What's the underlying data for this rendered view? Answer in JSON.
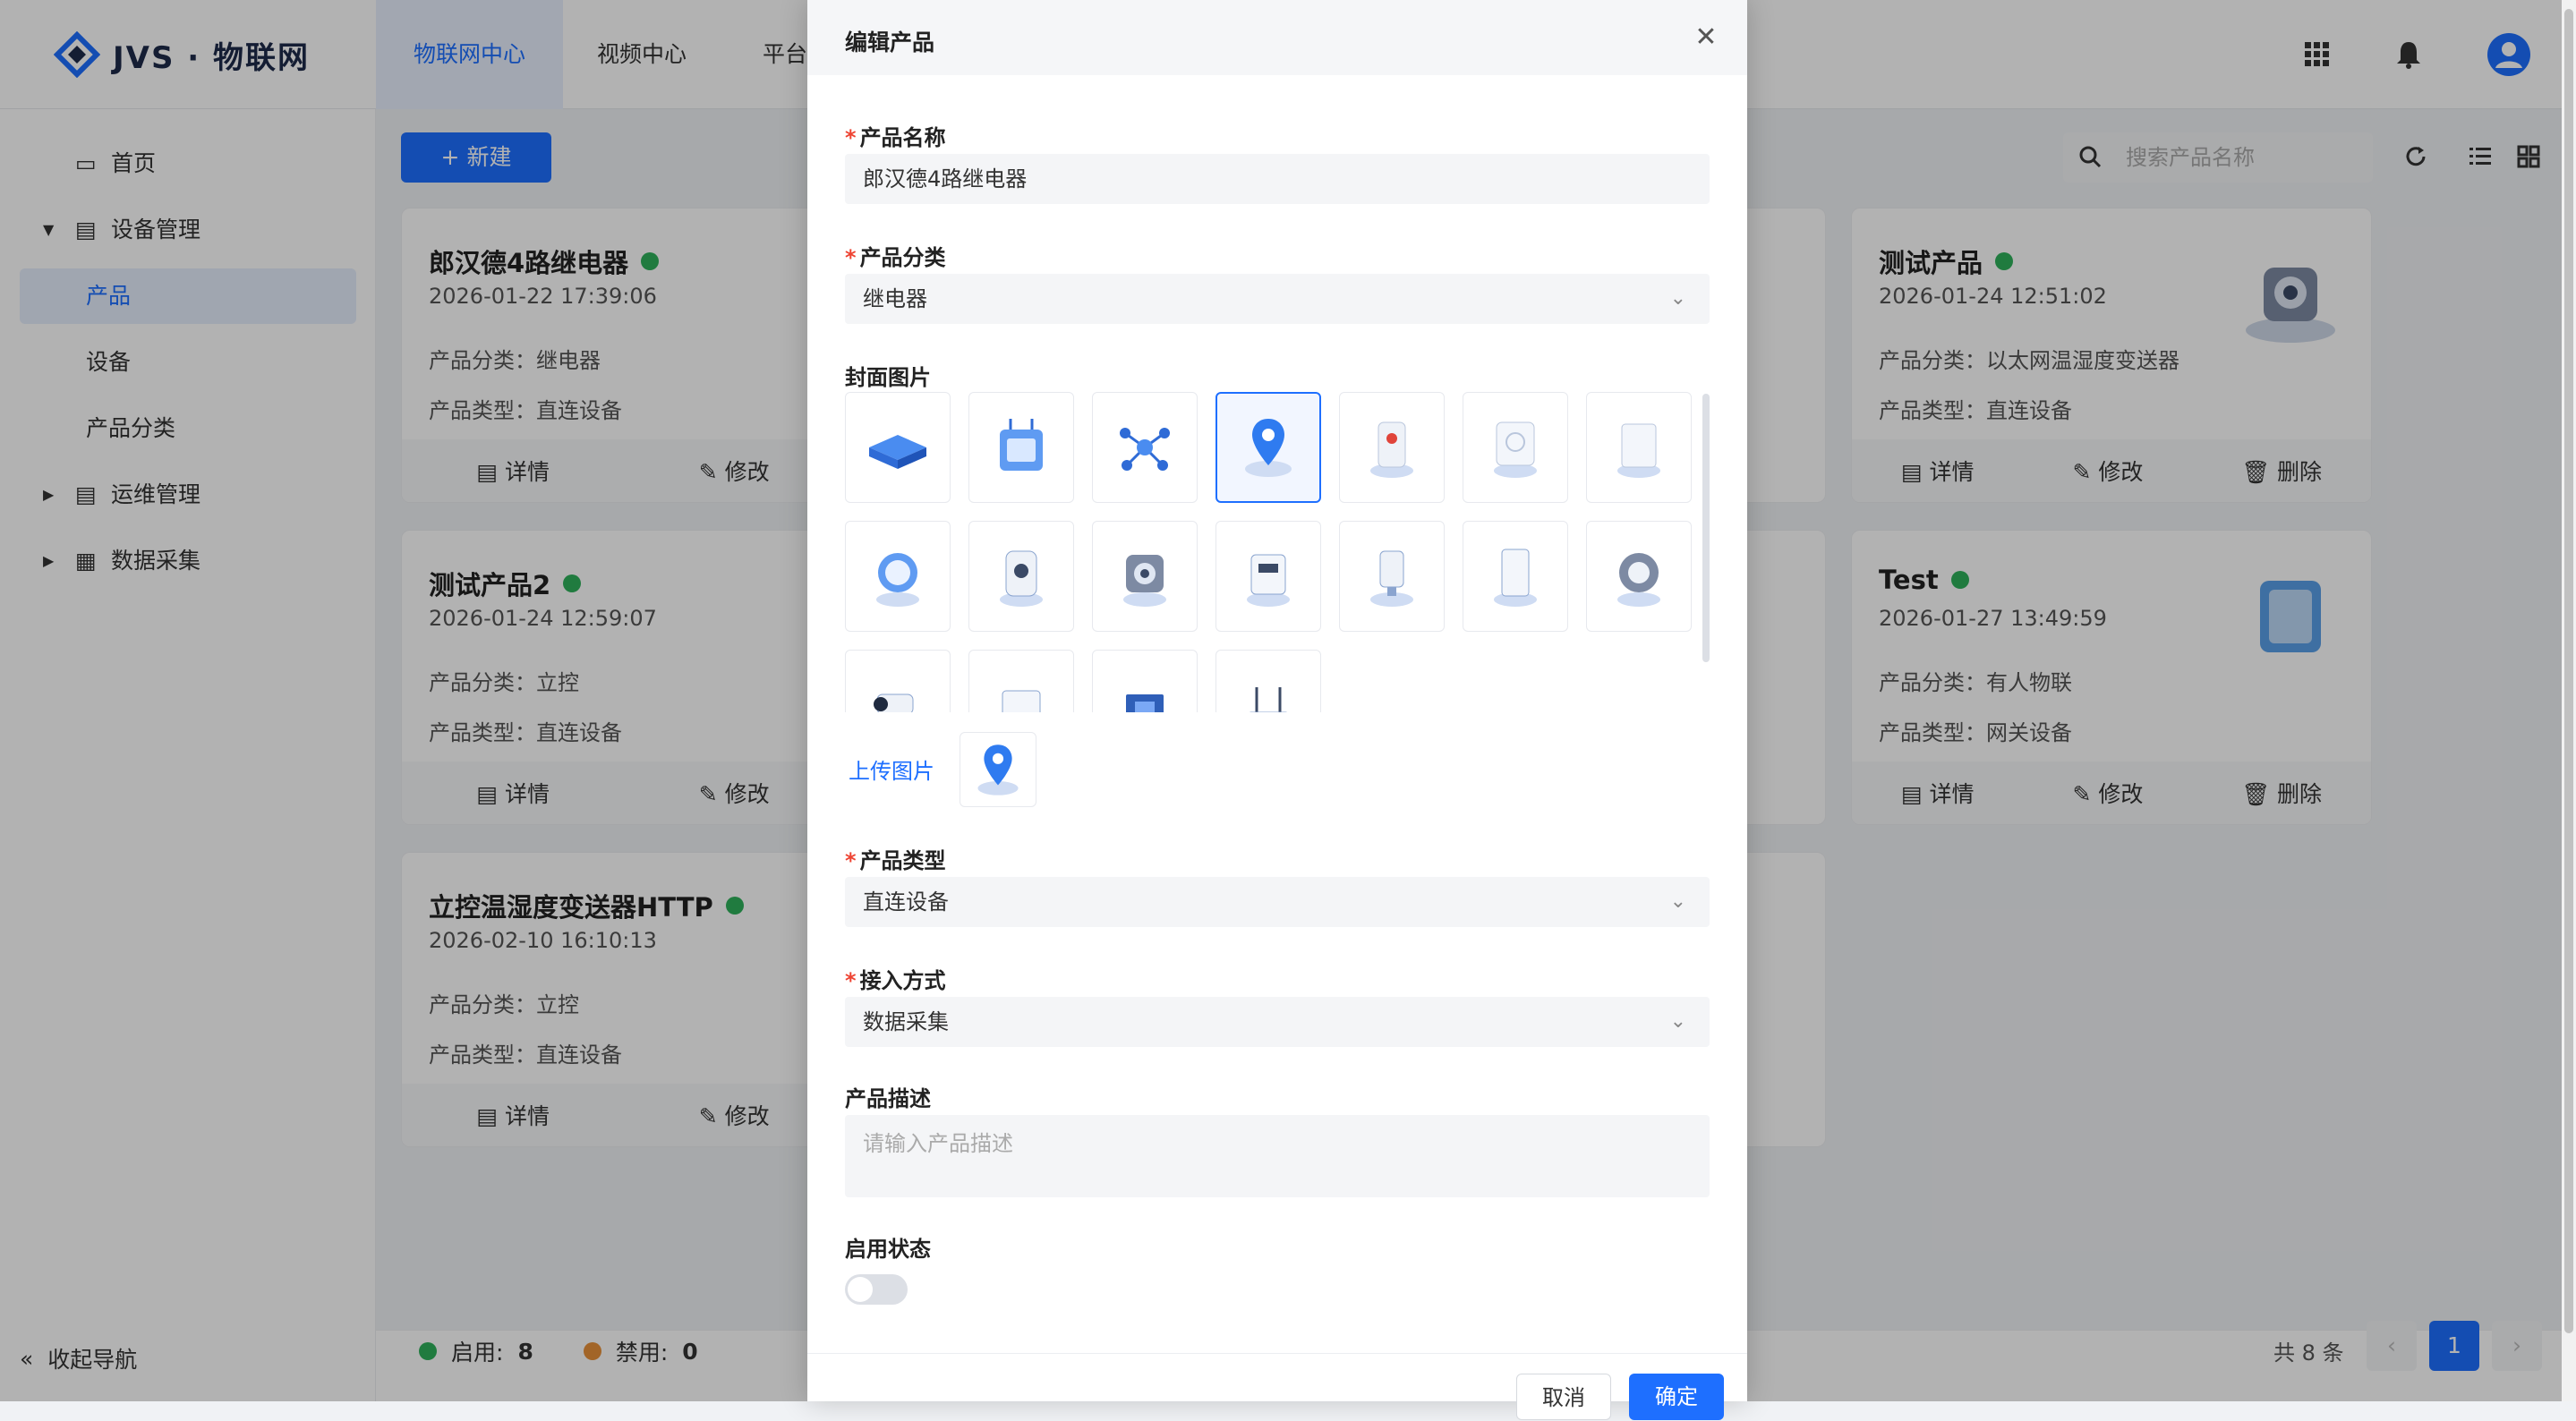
{
  "app": {
    "logo_text": "JVS · 物联网",
    "top_nav": [
      "物联网中心",
      "视频中心",
      "平台"
    ],
    "colors": {
      "accent": "#1e6fff",
      "enabled": "#2fb15b",
      "disabled": "#e8913a"
    }
  },
  "sidebar": {
    "items": [
      {
        "label": "首页",
        "icon": "monitor-icon"
      },
      {
        "label": "设备管理",
        "icon": "device-icon"
      },
      {
        "label": "产品"
      },
      {
        "label": "设备"
      },
      {
        "label": "产品分类"
      },
      {
        "label": "运维管理",
        "icon": "device-icon"
      },
      {
        "label": "数据采集",
        "icon": "data-icon"
      }
    ],
    "collapse_label": "收起导航"
  },
  "toolbar": {
    "new_label": "+ 新建",
    "search_placeholder": "搜索产品名称"
  },
  "cards": [
    {
      "title": "郎汉德4路继电器",
      "date": "2026-01-22 17:39:06",
      "category": "产品分类：继电器",
      "type": "产品类型：直连设备",
      "actions": [
        "详情",
        "修改"
      ]
    },
    {
      "title": "测试产品2",
      "date": "2026-01-24 12:59:07",
      "category": "产品分类：立控",
      "type": "产品类型：直连设备",
      "actions": [
        "详情",
        "修改"
      ]
    },
    {
      "title": "立控温湿度变送器HTTP",
      "date": "2026-02-10 16:10:13",
      "category": "产品分类：立控",
      "type": "产品类型：直连设备",
      "actions": [
        "详情",
        "修改"
      ]
    },
    {
      "title": "测试产品",
      "date": "2026-01-24 12:51:02",
      "category": "产品分类：以太网温湿度变送器",
      "type": "产品类型：直连设备",
      "actions": [
        "详情",
        "修改",
        "删除"
      ]
    },
    {
      "title": "Test",
      "date": "2026-01-27 13:49:59",
      "category": "产品分类：有人物联",
      "type": "产品类型：网关设备",
      "actions": [
        "详情",
        "修改",
        "删除"
      ]
    }
  ],
  "footer": {
    "enabled_label": "启用:",
    "enabled_count": "8",
    "disabled_label": "禁用:",
    "disabled_count": "0",
    "total": "共 8 条",
    "current_page": "1"
  },
  "modal": {
    "title": "编辑产品",
    "fields": {
      "name": {
        "label": "产品名称",
        "value": "郎汉德4路继电器"
      },
      "category": {
        "label": "产品分类",
        "value": "继电器"
      },
      "cover": {
        "label": "封面图片",
        "upload_label": "上传图片"
      },
      "type": {
        "label": "产品类型",
        "value": "直连设备"
      },
      "access": {
        "label": "接入方式",
        "value": "数据采集"
      },
      "desc": {
        "label": "产品描述",
        "placeholder": "请输入产品描述"
      },
      "status": {
        "label": "启用状态"
      }
    },
    "cancel_label": "取消",
    "ok_label": "确定"
  }
}
